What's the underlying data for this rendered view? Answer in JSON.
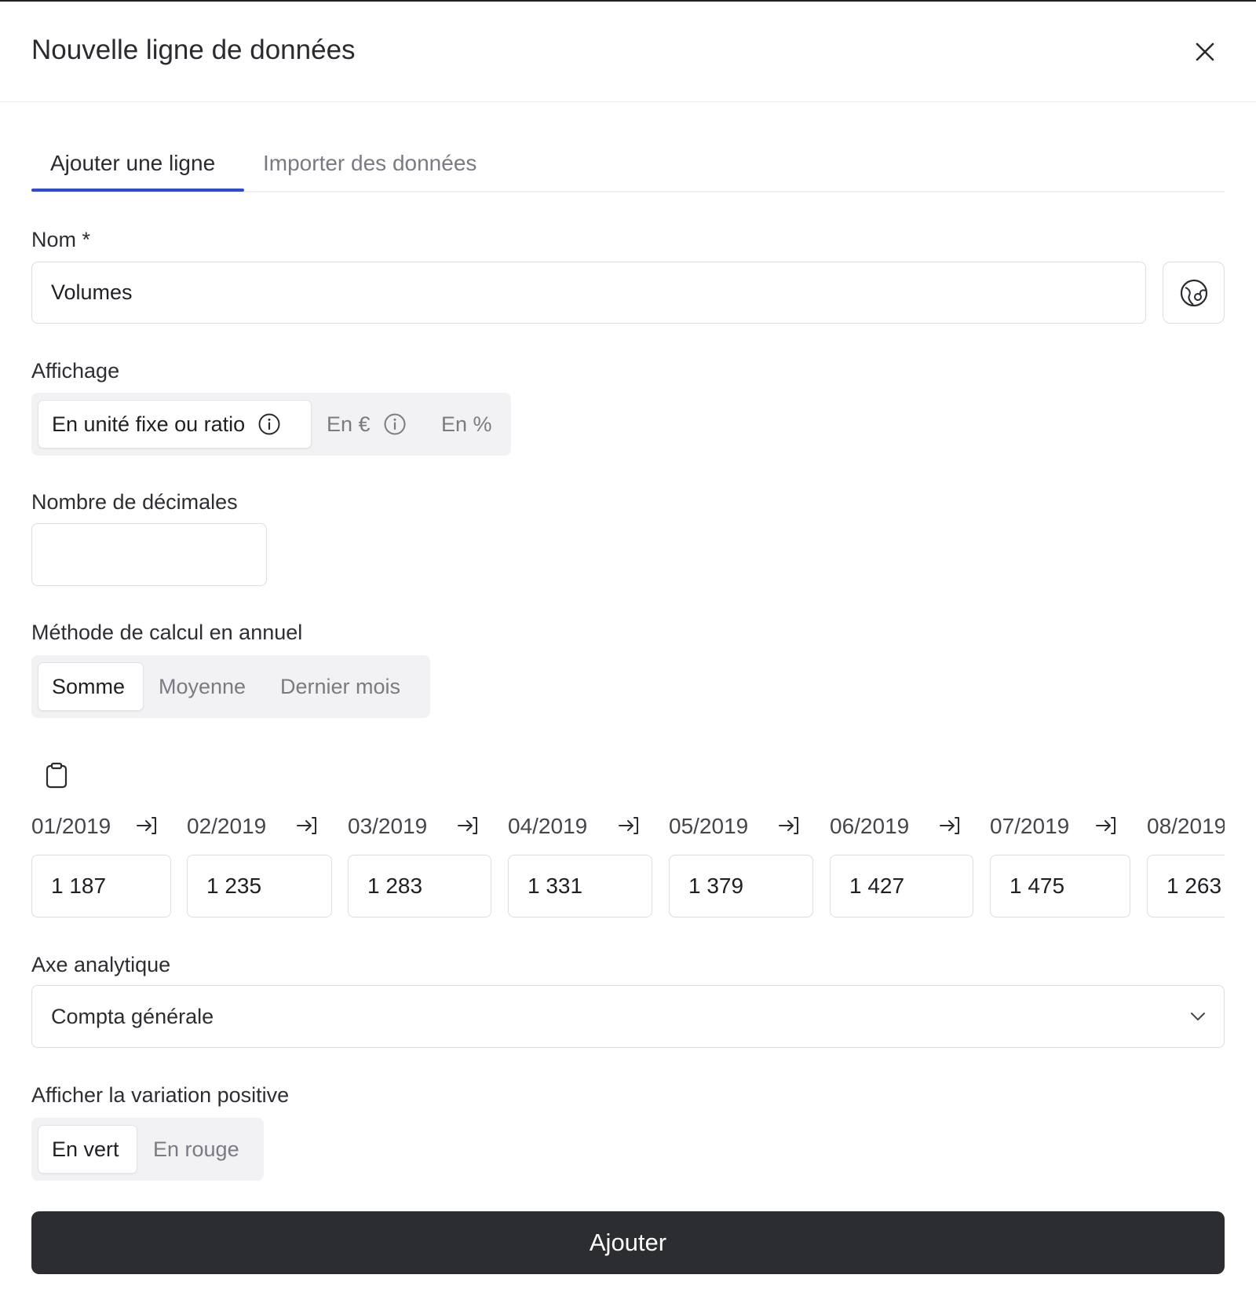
{
  "modal": {
    "title": "Nouvelle ligne de données"
  },
  "tabs": [
    {
      "label": "Ajouter une ligne",
      "active": true
    },
    {
      "label": "Importer des données",
      "active": false
    }
  ],
  "form": {
    "name": {
      "label": "Nom *",
      "value": "Volumes"
    },
    "display": {
      "label": "Affichage",
      "options": [
        "En unité fixe ou ratio",
        "En €",
        "En %"
      ],
      "selected": "En unité fixe ou ratio"
    },
    "decimals": {
      "label": "Nombre de décimales",
      "value": ""
    },
    "annual_method": {
      "label": "Méthode de calcul en annuel",
      "options": [
        "Somme",
        "Moyenne",
        "Dernier mois"
      ],
      "selected": "Somme"
    },
    "months": [
      {
        "month": "01/2019",
        "value": "1 187"
      },
      {
        "month": "02/2019",
        "value": "1 235"
      },
      {
        "month": "03/2019",
        "value": "1 283"
      },
      {
        "month": "04/2019",
        "value": "1 331"
      },
      {
        "month": "05/2019",
        "value": "1 379"
      },
      {
        "month": "06/2019",
        "value": "1 427"
      },
      {
        "month": "07/2019",
        "value": "1 475"
      },
      {
        "month": "08/2019",
        "value": "1 263"
      }
    ],
    "analytic_axis": {
      "label": "Axe analytique",
      "value": "Compta générale"
    },
    "positive_variation": {
      "label": "Afficher la variation positive",
      "options": [
        "En vert",
        "En rouge"
      ],
      "selected": "En vert"
    },
    "submit_label": "Ajouter"
  },
  "icons": {
    "close": "close-icon",
    "name_side": "palette-icon",
    "info": "info-icon",
    "clipboard": "clipboard-icon",
    "copy_right": "arrow-right-to-line-icon",
    "dropdown": "chevron-down-icon"
  }
}
